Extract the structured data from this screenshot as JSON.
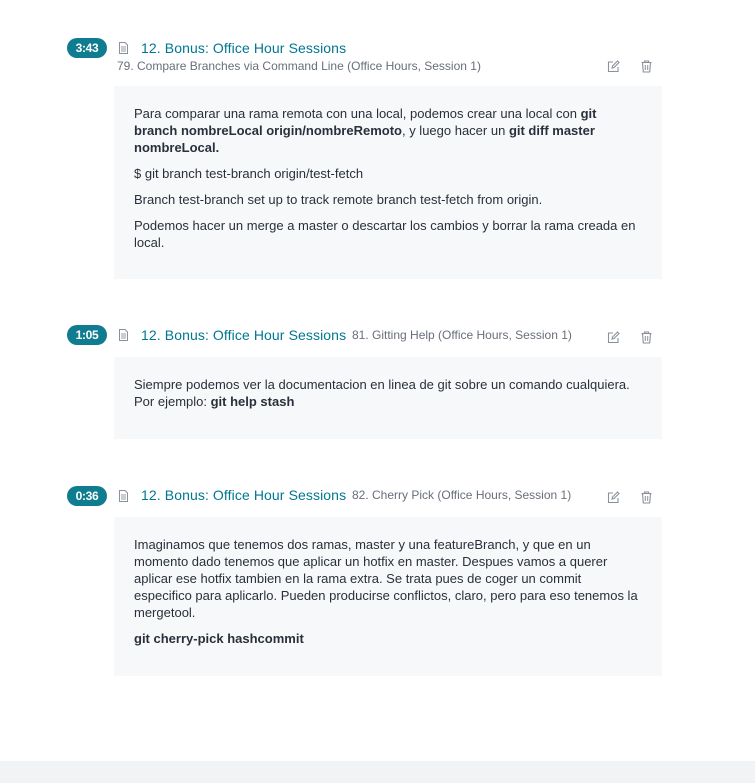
{
  "notes": [
    {
      "timestamp": "3:43",
      "section": "12. Bonus: Office Hour Sessions",
      "lecture": "79. Compare Branches via Command Line (Office Hours, Session 1)",
      "content": [
        {
          "parts": [
            {
              "text": "Para comparar una rama remota con una local, podemos crear una local con ",
              "bold": false
            },
            {
              "text": "git branch nombreLocal origin/nombreRemoto",
              "bold": true
            },
            {
              "text": ", y luego hacer un ",
              "bold": false
            },
            {
              "text": "git diff master nombreLocal.",
              "bold": true
            }
          ]
        },
        {
          "parts": [
            {
              "text": "$ git branch test-branch origin/test-fetch",
              "bold": false
            }
          ]
        },
        {
          "parts": [
            {
              "text": "Branch test-branch set up to track remote branch test-fetch from origin.",
              "bold": false
            }
          ]
        },
        {
          "parts": [
            {
              "text": "Podemos hacer un merge a master o descartar los cambios y borrar la rama creada en local.",
              "bold": false
            }
          ]
        }
      ]
    },
    {
      "timestamp": "1:05",
      "section": "12. Bonus: Office Hour Sessions",
      "lecture": "81. Gitting Help (Office Hours, Session 1)",
      "content": [
        {
          "parts": [
            {
              "text": "Siempre podemos ver la documentacion en linea de git sobre un comando cualquiera. Por ejemplo: ",
              "bold": false
            },
            {
              "text": "git help stash",
              "bold": true
            }
          ]
        }
      ]
    },
    {
      "timestamp": "0:36",
      "section": "12. Bonus: Office Hour Sessions",
      "lecture": "82. Cherry Pick (Office Hours, Session 1)",
      "content": [
        {
          "parts": [
            {
              "text": "Imaginamos que tenemos dos ramas, master y una featureBranch, y que en un momento dado tenemos que aplicar un hotfix en master. Despues vamos a querer aplicar ese hotfix tambien en la rama extra. Se trata pues de coger un commit especifico para aplicarlo. Pueden producirse conflictos, claro, pero para eso tenemos la mergetool.",
              "bold": false
            }
          ]
        },
        {
          "parts": [
            {
              "text": "git cherry-pick hashcommit",
              "bold": true
            }
          ]
        }
      ]
    }
  ],
  "icons": {
    "lecture": "document-icon",
    "edit": "edit-icon",
    "delete": "trash-icon"
  },
  "colors": {
    "accent": "#0f7c90",
    "section_link": "#007791",
    "card_background": "#f7f8fa",
    "muted_text": "#686f7a"
  }
}
